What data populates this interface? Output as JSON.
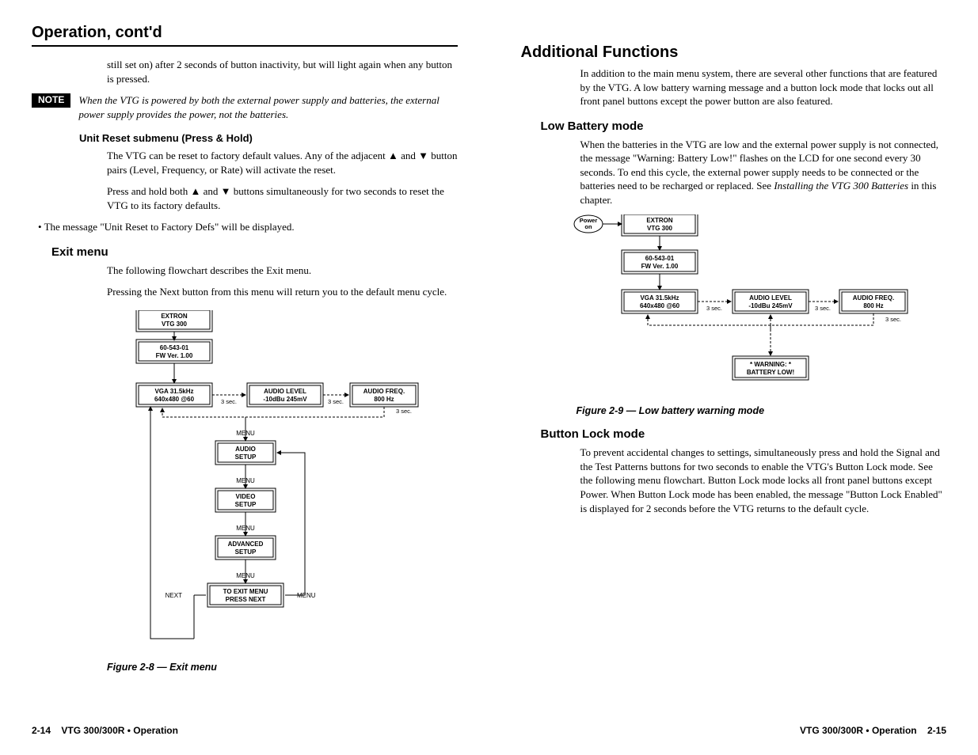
{
  "header": "Operation, cont'd",
  "left": {
    "p1": "still set on) after 2 seconds of button inactivity, but will light again when any button is pressed.",
    "note_label": "NOTE",
    "note_text": "When the VTG is powered by both the external power supply and batteries, the external power supply provides the power, not the batteries.",
    "sub1": "Unit Reset submenu (Press & Hold)",
    "p2a": "The VTG can be reset to factory default values.  Any of the adjacent ",
    "p2b": " and ",
    "p2c": " button pairs (Level, Frequency, or Rate) will activate the reset.",
    "p3a": "Press and hold both ",
    "p3b": " and ",
    "p3c": " buttons simultaneously for two seconds to reset the VTG to its factory defaults.",
    "bullet1": "•  The message \"Unit Reset to Factory Defs\" will be displayed.",
    "h3_exit": "Exit menu",
    "p4": "The following flowchart describes the Exit menu.",
    "p5": "Pressing the Next button from this menu will return you to the default menu cycle.",
    "fig8": "Figure 2-8 — Exit menu",
    "boxes": {
      "extron1": "EXTRON",
      "extron2": "VTG    300",
      "fw1": "60-543-01",
      "fw2": "FW  Ver. 1.00",
      "vga1": "VGA   31.5kHz",
      "vga2": "640x480 @60",
      "al1": "AUDIO LEVEL",
      "al2": "-10dBu  245mV",
      "af1": "AUDIO FREQ.",
      "af2": "800 Hz",
      "menu": "MENU",
      "next": "NEXT",
      "sec": "3 sec.",
      "audio_setup": "AUDIO\nSETUP",
      "video_setup": "VIDEO\nSETUP",
      "adv_setup": "ADVANCED\nSETUP",
      "exit1": "TO EXIT MENU",
      "exit2": "PRESS NEXT"
    }
  },
  "right": {
    "h2": "Additional Functions",
    "p1": "In addition to the main menu system, there are several other functions that are featured by the VTG.  A low battery warning message and a button lock mode that locks out all front panel buttons except the power button are also featured.",
    "h3_low": "Low Battery mode",
    "p2a": "When the batteries in the VTG are low and the external power supply is not connected, the message \"Warning: Battery Low!\" flashes on the LCD for one second every 30 seconds.  To end this cycle, the external power supply needs to be connected or the batteries need to be recharged or replaced.  See ",
    "p2b": "Installing the VTG 300 Batteries",
    "p2c": " in this chapter.",
    "fig9": "Figure 2-9 — Low battery warning mode",
    "h3_btn": "Button Lock mode",
    "p3": "To prevent accidental changes to settings, simultaneously press and hold the Signal and the Test Patterns buttons for two seconds to enable the VTG's Button Lock mode.  See the following menu flowchart.  Button Lock mode locks all front panel buttons except Power.  When Button Lock mode has been enabled, the message \"Button Lock Enabled\" is displayed for 2 seconds before the VTG returns to the default cycle.",
    "boxes": {
      "power": "Power\non",
      "warn1": "* WARNING:  *",
      "warn2": "BATTERY LOW!"
    }
  },
  "footer": {
    "left_pn": "2-14",
    "left_ti": "VTG 300/300R • Operation",
    "right_ti": "VTG 300/300R • Operation",
    "right_pn": "2-15"
  }
}
